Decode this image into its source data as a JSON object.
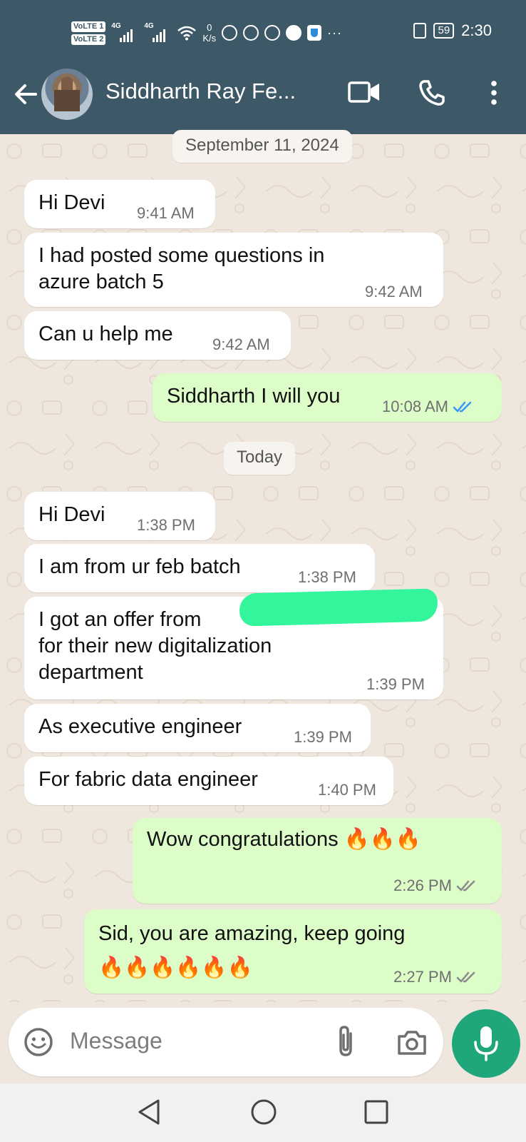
{
  "status_bar": {
    "sim1": "VoLTE 1",
    "sim2": "VoLTE 2",
    "net1": "4G",
    "net2": "4G",
    "speed_value": "0",
    "speed_unit": "K/s",
    "more": "···",
    "battery": "59",
    "time": "2:30"
  },
  "header": {
    "contact_name": "Siddharth Ray Fe...",
    "back_icon": "arrow-left-icon",
    "video_icon": "video-call-icon",
    "call_icon": "phone-icon",
    "menu_icon": "more-vertical-icon"
  },
  "chat": {
    "date_dividers": [
      "September 11, 2024",
      "Today"
    ],
    "messages": [
      {
        "dir": "in",
        "text": "Hi Devi",
        "time": "9:41 AM"
      },
      {
        "dir": "in",
        "text": "I had posted some questions in\nazure batch 5",
        "time": "9:42 AM"
      },
      {
        "dir": "in",
        "text": "Can u help me",
        "time": "9:42 AM"
      },
      {
        "dir": "out",
        "text": "Siddharth I will you",
        "time": "10:08 AM",
        "status": "read"
      },
      {
        "dir": "in",
        "text": "Hi Devi",
        "time": "1:38 PM"
      },
      {
        "dir": "in",
        "text": "I am from ur feb batch",
        "time": "1:38 PM"
      },
      {
        "dir": "in",
        "text": "I got an offer from\nfor their new digitalization\ndepartment",
        "time": "1:39 PM",
        "redacted": true
      },
      {
        "dir": "in",
        "text": "As executive engineer",
        "time": "1:39 PM"
      },
      {
        "dir": "in",
        "text": "For fabric data engineer",
        "time": "1:40 PM"
      },
      {
        "dir": "out",
        "text": "Wow congratulations 🔥🔥🔥",
        "time": "2:26 PM",
        "status": "delivered"
      },
      {
        "dir": "out",
        "text": "Sid, you are amazing, keep going\n🔥🔥🔥🔥🔥🔥",
        "time": "2:27 PM",
        "status": "delivered"
      }
    ]
  },
  "composer": {
    "placeholder": "Message",
    "emoji_icon": "smiley-icon",
    "attach_icon": "paperclip-icon",
    "camera_icon": "camera-icon",
    "mic_icon": "microphone-icon"
  },
  "colors": {
    "header_bg": "#3d5866",
    "incoming_bubble": "#ffffff",
    "outgoing_bubble": "#dcfcc8",
    "read_tick": "#3497f9",
    "mic_button": "#1fa77b",
    "chat_bg": "#efe7de"
  }
}
